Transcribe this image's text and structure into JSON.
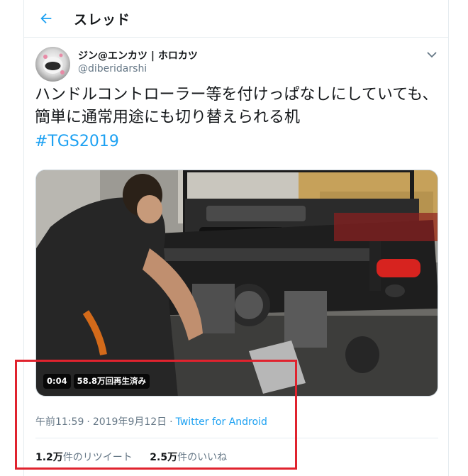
{
  "header": {
    "title": "スレッド",
    "back_icon": "arrow-left-icon"
  },
  "tweet": {
    "author": {
      "display_name": "ジン@エンカツ | ホロカツ",
      "handle": "@diberidarshi"
    },
    "text": "ハンドルコントローラー等を付けっぱなしにしていても、簡単に通常用途にも切り替えられる机",
    "hashtag": "#TGS2019",
    "video": {
      "duration": "0:04",
      "views": "58.8万回再生済み"
    },
    "meta": {
      "time": "午前11:59",
      "separator": "·",
      "date": "2019年9月12日",
      "source": "Twitter for Android"
    },
    "stats": {
      "retweets_count": "1.2万",
      "retweets_label": "件のリツイート",
      "likes_count": "2.5万",
      "likes_label": "件のいいね"
    }
  },
  "colors": {
    "accent": "#1da1f2",
    "highlight": "#e0232e",
    "text": "#14171a",
    "secondary": "#657786"
  }
}
